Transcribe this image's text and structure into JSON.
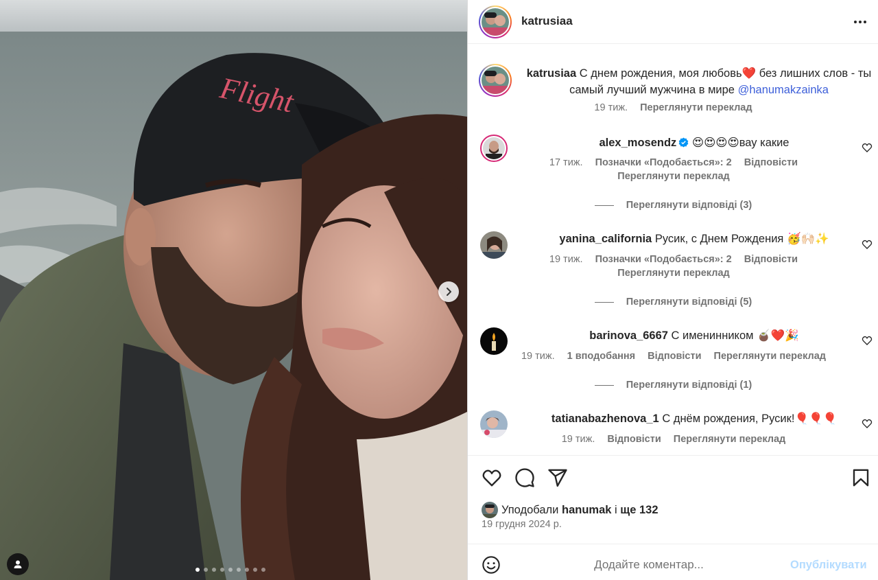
{
  "post": {
    "username": "katrusiaa",
    "media_pages": 9,
    "active_page": 1
  },
  "caption": {
    "username": "katrusiaa",
    "text": "С днем рождения, моя любовь❤️ без лишних слов - ты самый лучший мужчина в мире",
    "mention": "@hanumakzainka",
    "age": "19 тиж.",
    "translate": "Переглянути переклад"
  },
  "comments": [
    {
      "username": "alex_mosendz",
      "verified": true,
      "text": "😍😍😍😍вау какие",
      "age": "17 тиж.",
      "likes": "Позначки «Подобається»: 2",
      "reply": "Відповісти",
      "translate": "Переглянути переклад",
      "view_replies": "Переглянути відповіді (3)"
    },
    {
      "username": "yanina_california",
      "verified": false,
      "text": "Русик, с Днем Рождения 🥳🙌🏻✨",
      "age": "19 тиж.",
      "likes": "Позначки «Подобається»: 2",
      "reply": "Відповісти",
      "translate": "Переглянути переклад",
      "view_replies": "Переглянути відповіді (5)"
    },
    {
      "username": "barinova_6667",
      "verified": false,
      "text": "С именинником 🧉❤️🎉",
      "age": "19 тиж.",
      "likes": "1 вподобання",
      "reply": "Відповісти",
      "translate": "Переглянути переклад",
      "view_replies": "Переглянути відповіді (1)"
    },
    {
      "username": "tatianabazhenova_1",
      "verified": false,
      "text": "С днём рождения, Русик!🎈🎈🎈",
      "age": "19 тиж.",
      "reply": "Відповісти",
      "translate": "Переглянути переклад"
    }
  ],
  "likes": {
    "prefix": "Уподобали",
    "user": "hanumak",
    "connector": "і",
    "rest": "ще 132"
  },
  "date": "19 грудня 2024 р.",
  "composer": {
    "placeholder": "Додайте коментар...",
    "publish": "Опублікувати"
  },
  "icons": [
    "more-icon",
    "heart-icon",
    "comment-icon",
    "share-icon",
    "bookmark-icon",
    "emoji-icon",
    "chevron-right-icon",
    "user-tag-icon",
    "verified-icon"
  ],
  "colors": {
    "link": "#3d5fd9",
    "muted": "#737373",
    "publish_disabled": "#b3dbff",
    "verified": "#0095f6"
  }
}
